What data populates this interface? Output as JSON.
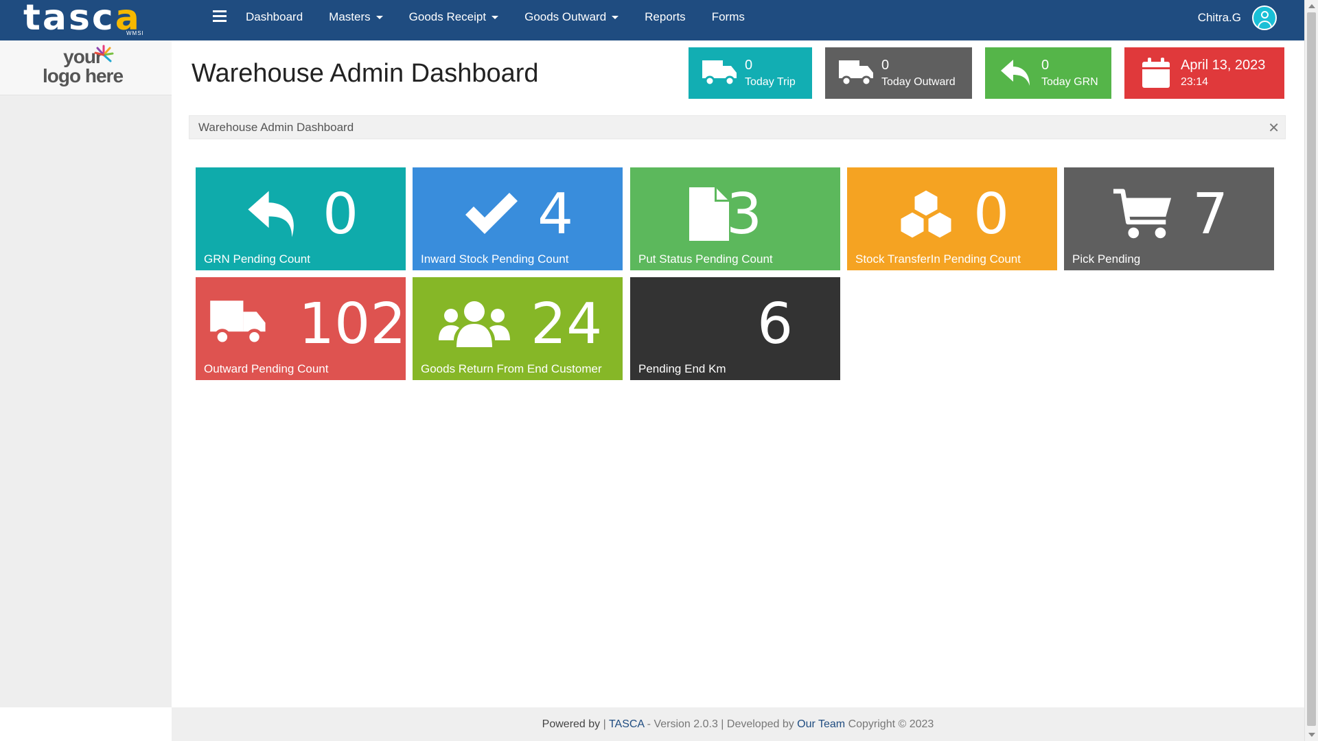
{
  "brand": {
    "name_left": "tasc",
    "name_accent": "a",
    "sub": "WMSI"
  },
  "nav": {
    "items": [
      {
        "label": "Dashboard",
        "dropdown": false
      },
      {
        "label": "Masters",
        "dropdown": true
      },
      {
        "label": "Goods Receipt",
        "dropdown": true
      },
      {
        "label": "Goods Outward",
        "dropdown": true
      },
      {
        "label": "Reports",
        "dropdown": false
      },
      {
        "label": "Forms",
        "dropdown": false
      }
    ],
    "user": "Chitra.G"
  },
  "sidebar": {
    "logo_line1": "your",
    "logo_line2": "logo here"
  },
  "page": {
    "title": "Warehouse Admin Dashboard",
    "breadcrumb": "Warehouse Admin Dashboard",
    "close": "✕"
  },
  "header_stats": [
    {
      "value": "0",
      "label": "Today Trip",
      "icon": "truck-icon",
      "color": "#12aeb3"
    },
    {
      "value": "0",
      "label": "Today Outward",
      "icon": "truck-icon",
      "color": "#5f5f5f"
    },
    {
      "value": "0",
      "label": "Today GRN",
      "icon": "reply-icon",
      "color": "#55b549"
    },
    {
      "value": "April 13, 2023",
      "label": "23:14",
      "icon": "calendar-icon",
      "color": "#e0393b"
    }
  ],
  "tiles": [
    {
      "value": "0",
      "label": "GRN Pending Count",
      "icon": "reply-icon",
      "color": "#0fabab"
    },
    {
      "value": "4",
      "label": "Inward Stock Pending Count",
      "icon": "check-icon",
      "color": "#398ddc"
    },
    {
      "value": "3",
      "label": "Put Status Pending Count",
      "icon": "file-icon",
      "color": "#5cb85c"
    },
    {
      "value": "0",
      "label": "Stock TransferIn Pending Count",
      "icon": "cubes-icon",
      "color": "#f5a322"
    },
    {
      "value": "7",
      "label": "Pick Pending",
      "icon": "cart-icon",
      "color": "#5f5f5f"
    },
    {
      "value": "102",
      "label": "Outward Pending Count",
      "icon": "truck-icon",
      "color": "#de5350"
    },
    {
      "value": "24",
      "label": "Goods Return From End Customer",
      "icon": "users-icon",
      "color": "#86b727"
    },
    {
      "value": "6",
      "label": "Pending End Km",
      "icon": "",
      "color": "#333333"
    }
  ],
  "footer": {
    "powered": "Powered by",
    "sep1": " | ",
    "brand": "TASCA",
    "version": " - Version 2.0.3 | Developed by ",
    "team": "Our Team",
    "copyright": " Copyright © 2023"
  }
}
